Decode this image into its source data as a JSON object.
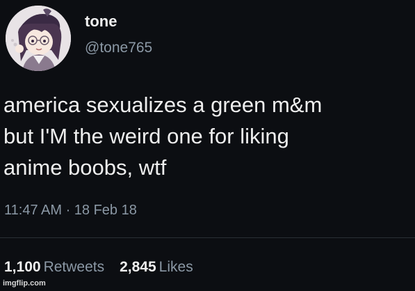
{
  "user": {
    "display_name": "tone",
    "handle": "@tone765"
  },
  "avatar": {
    "icon": "anime-character-avatar",
    "background_color": "#e8e3e6"
  },
  "tweet": {
    "text": "america sexualizes a green m&m\nbut I'M the weird one for liking\nanime boobs, wtf",
    "timestamp": "11:47 AM · 18 Feb 18"
  },
  "stats": {
    "retweets_count": "1,100",
    "retweets_label": "Retweets",
    "likes_count": "2,845",
    "likes_label": "Likes"
  },
  "watermark": {
    "text": "imgflip.com"
  },
  "colors": {
    "background": "#0c0e12",
    "text_primary": "#eeeeee",
    "text_secondary": "#8b98a5"
  }
}
